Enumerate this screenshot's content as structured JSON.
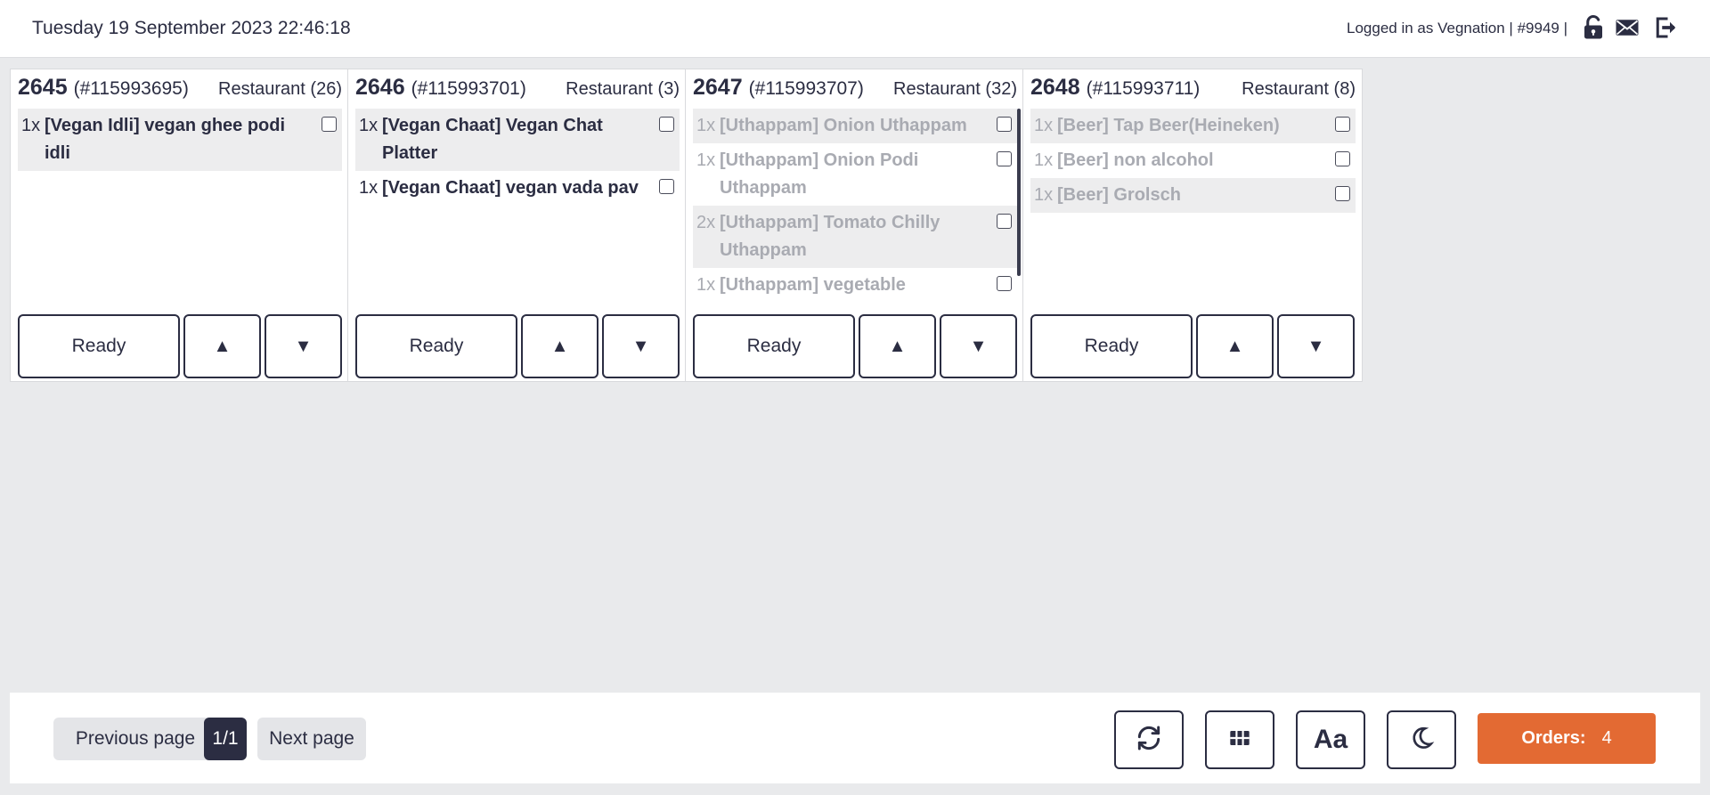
{
  "header": {
    "datetime": "Tuesday 19 September 2023 22:46:18",
    "user_info": "Logged in as Vegnation | #9949 |"
  },
  "orders": [
    {
      "number": "2645",
      "reference": "(#115993695)",
      "table": "Restaurant (26)",
      "items": [
        {
          "qty": "1x",
          "name": "[Vegan Idli] vegan ghee podi idli",
          "done": false,
          "shaded": true
        }
      ],
      "ready_label": "Ready",
      "up_label": "▲",
      "down_label": "▼"
    },
    {
      "number": "2646",
      "reference": "(#115993701)",
      "table": "Restaurant (3)",
      "items": [
        {
          "qty": "1x",
          "name": "[Vegan Chaat] Vegan Chat Platter",
          "done": false,
          "shaded": true
        },
        {
          "qty": "1x",
          "name": "[Vegan Chaat] vegan vada pav",
          "done": false,
          "shaded": false
        }
      ],
      "ready_label": "Ready",
      "up_label": "▲",
      "down_label": "▼"
    },
    {
      "number": "2647",
      "reference": "(#115993707)",
      "table": "Restaurant (32)",
      "items": [
        {
          "qty": "1x",
          "name": "[Uthappam] Onion Uthappam",
          "done": true,
          "shaded": true
        },
        {
          "qty": "1x",
          "name": "[Uthappam] Onion Podi Uthappam",
          "done": true,
          "shaded": false
        },
        {
          "qty": "2x",
          "name": "[Uthappam] Tomato Chilly Uthappam",
          "done": true,
          "shaded": true
        },
        {
          "qty": "1x",
          "name": "[Uthappam] vegetable",
          "done": true,
          "shaded": false
        }
      ],
      "ready_label": "Ready",
      "up_label": "▲",
      "down_label": "▼"
    },
    {
      "number": "2648",
      "reference": "(#115993711)",
      "table": "Restaurant (8)",
      "items": [
        {
          "qty": "1x",
          "name": "[Beer] Tap Beer(Heineken)",
          "done": true,
          "shaded": true
        },
        {
          "qty": "1x",
          "name": "[Beer] non alcohol",
          "done": true,
          "shaded": false
        },
        {
          "qty": "1x",
          "name": "[Beer] Grolsch",
          "done": true,
          "shaded": true
        }
      ],
      "ready_label": "Ready",
      "up_label": "▲",
      "down_label": "▼"
    }
  ],
  "footer": {
    "prev_label": "Previous page",
    "page_indicator": "1/1",
    "next_label": "Next page",
    "font_toggle_label": "Aa",
    "orders_label": "Orders:",
    "orders_count": "4"
  },
  "colors": {
    "accent": "#e36a33",
    "dark": "#2b2d42",
    "done_text": "#a9abb2",
    "background": "#e9eaec"
  },
  "icons": {
    "header": [
      "lock-icon",
      "mail-icon",
      "logout-icon"
    ],
    "toolbar": [
      "refresh-icon",
      "grid-icon",
      "font-size-icon",
      "dark-mode-icon"
    ]
  }
}
